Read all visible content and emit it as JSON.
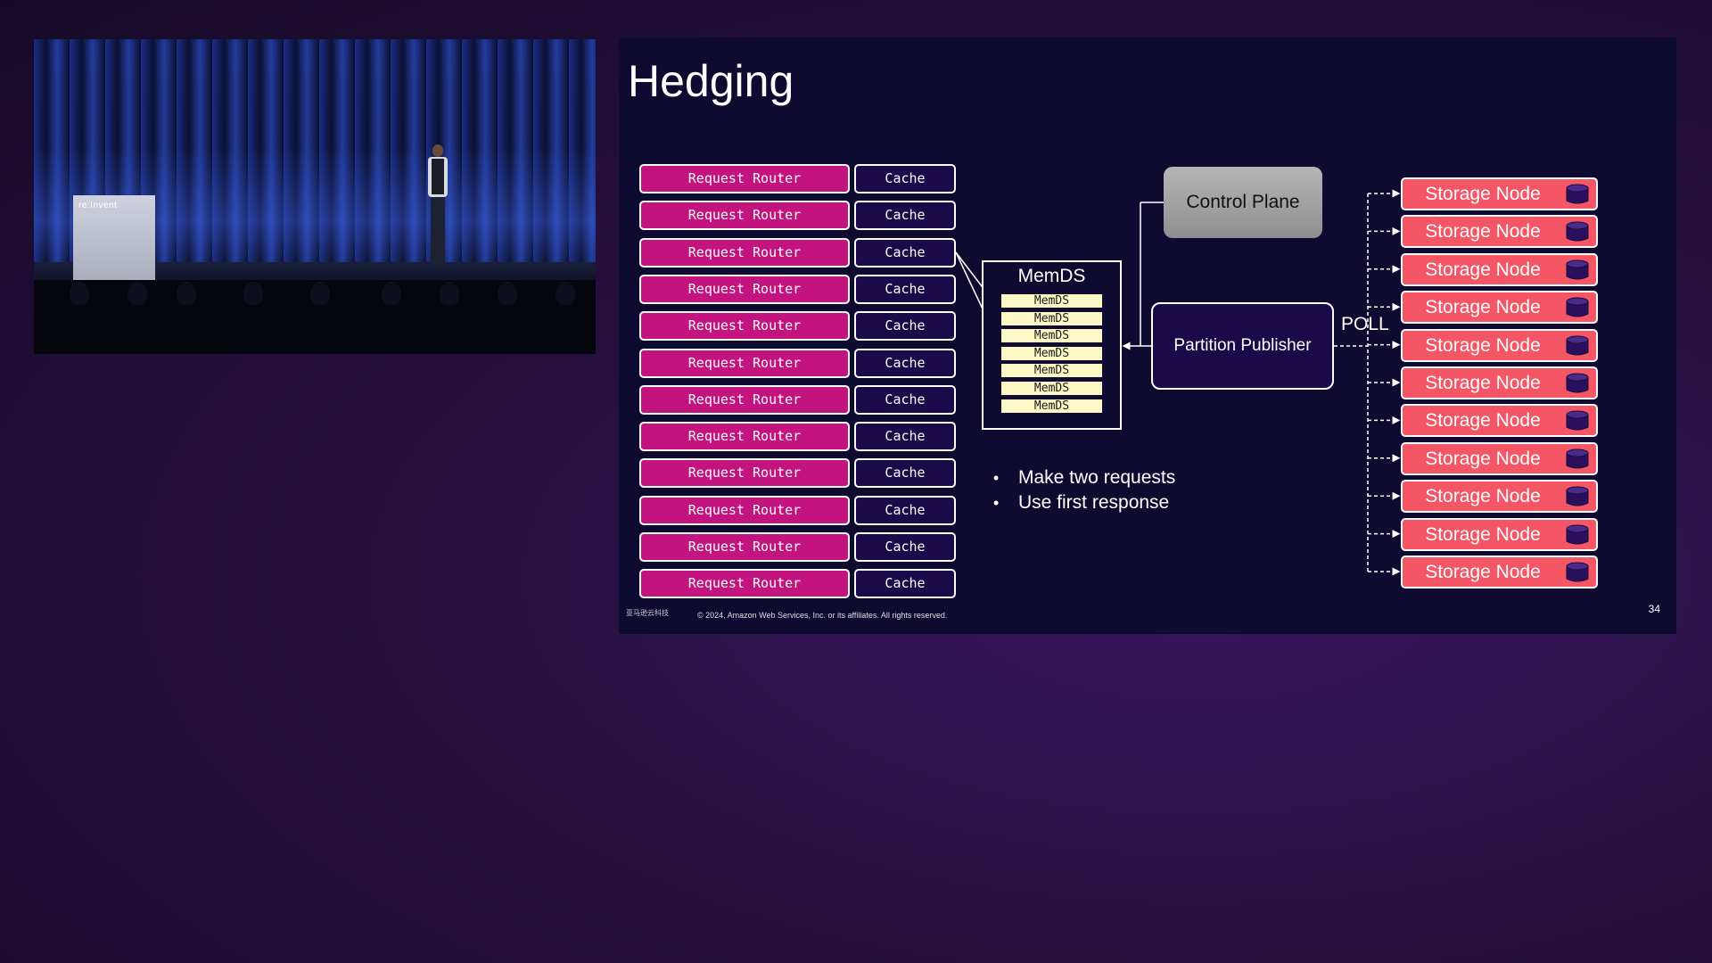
{
  "video": {
    "podium_logo": "re:Invent"
  },
  "slide": {
    "title": "Hedging",
    "request_router_label": "Request Router",
    "cache_label": "Cache",
    "rows": 12,
    "memds": {
      "title": "MemDS",
      "items": [
        "MemDS",
        "MemDS",
        "MemDS",
        "MemDS",
        "MemDS",
        "MemDS",
        "MemDS"
      ]
    },
    "control_plane": "Control Plane",
    "partition_publisher": "Partition Publisher",
    "poll_label": "POLL",
    "storage_node_label": "Storage Node",
    "storage_nodes": 11,
    "bullets": [
      "Make two requests",
      "Use first response"
    ],
    "footer_logo": "亚马逊云科技",
    "copyright": "© 2024, Amazon Web Services, Inc. or its affiliates. All rights reserved.",
    "page_number": "34"
  },
  "colors": {
    "request_router": "#c2137f",
    "cache": "#1a0a4a",
    "memds_item": "#fbf8c6",
    "control_plane": "#a6a6a6",
    "storage_node": "#f55665",
    "slide_bg": "#0e0a30"
  }
}
